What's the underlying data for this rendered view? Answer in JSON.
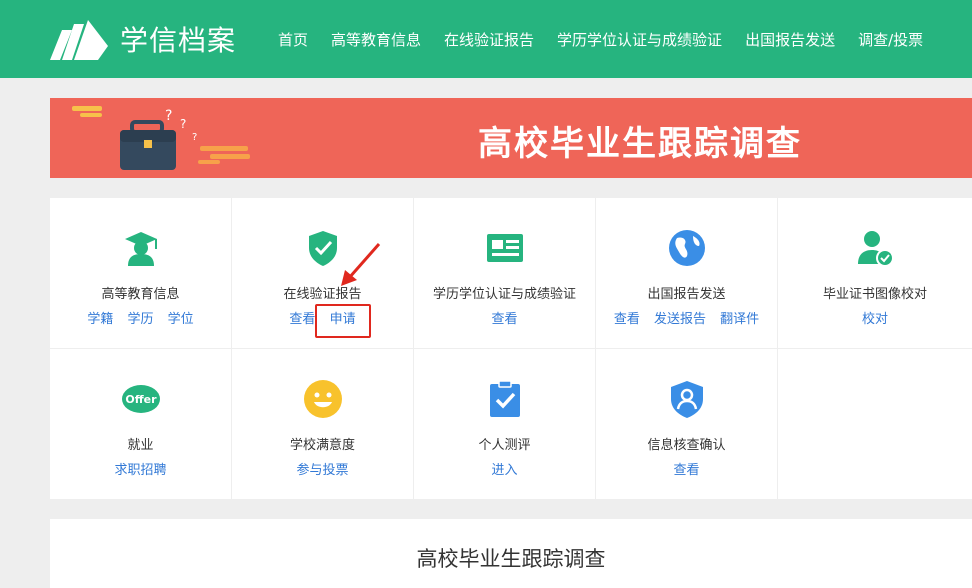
{
  "header": {
    "logo_text": "学信档案",
    "nav": [
      "首页",
      "高等教育信息",
      "在线验证报告",
      "学历学位认证与成绩验证",
      "出国报告发送",
      "调查/投票"
    ]
  },
  "banner": {
    "title": "高校毕业生跟踪调查"
  },
  "services": [
    {
      "title": "高等教育信息",
      "icon": "graduate-icon",
      "links": [
        "学籍",
        "学历",
        "学位"
      ]
    },
    {
      "title": "在线验证报告",
      "icon": "shield-check-icon",
      "links": [
        "查看",
        "申请"
      ]
    },
    {
      "title": "学历学位认证与成绩验证",
      "icon": "id-card-icon",
      "links": [
        "查看"
      ]
    },
    {
      "title": "出国报告发送",
      "icon": "globe-icon",
      "links": [
        "查看",
        "发送报告",
        "翻译件"
      ]
    },
    {
      "title": "毕业证书图像校对",
      "icon": "user-check-icon",
      "links": [
        "校对"
      ]
    },
    {
      "title": "就业",
      "icon": "offer-icon",
      "icon_text": "Offer",
      "links": [
        "求职招聘"
      ]
    },
    {
      "title": "学校满意度",
      "icon": "smiley-icon",
      "links": [
        "参与投票"
      ]
    },
    {
      "title": "个人测评",
      "icon": "clipboard-check-icon",
      "links": [
        "进入"
      ]
    },
    {
      "title": "信息核查确认",
      "icon": "shield-user-icon",
      "links": [
        "查看"
      ]
    }
  ],
  "bottom": {
    "title": "高校毕业生跟踪调查"
  },
  "colors": {
    "header": "#26b47f",
    "banner": "#ef6558",
    "link": "#3279d6",
    "highlight": "#e0281e"
  }
}
